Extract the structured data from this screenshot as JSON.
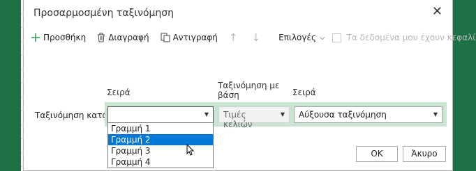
{
  "dialog": {
    "title": "Προσαρμοσμένη ταξινόμηση"
  },
  "toolbar": {
    "add_label": "Προσθήκη",
    "delete_label": "Διαγραφή",
    "copy_label": "Αντιγραφή",
    "options_label": "Επιλογές",
    "headers_label": "Τα δεδομένα μου έχουν κεφαλίδες"
  },
  "columns": {
    "column": "Σειρά",
    "sort_on": "Ταξινόμηση με βάση",
    "order": "Σειρά"
  },
  "sort_row": {
    "label": "Ταξινόμηση κατά",
    "column_value": "",
    "sort_on_value": "Τιμές κελιών",
    "order_value": "Αύξουσα ταξινόμηση"
  },
  "dropdown": {
    "options": [
      "Γραμμή 1",
      "Γραμμή 2",
      "Γραμμή 3",
      "Γραμμή 4"
    ],
    "selected": "Γραμμή 2"
  },
  "buttons": {
    "ok": "OK",
    "cancel": "Άκυρο"
  },
  "colors": {
    "accent_green": "#1e7145",
    "highlight": "#0078d7",
    "row_band": "#c9e5d1"
  }
}
